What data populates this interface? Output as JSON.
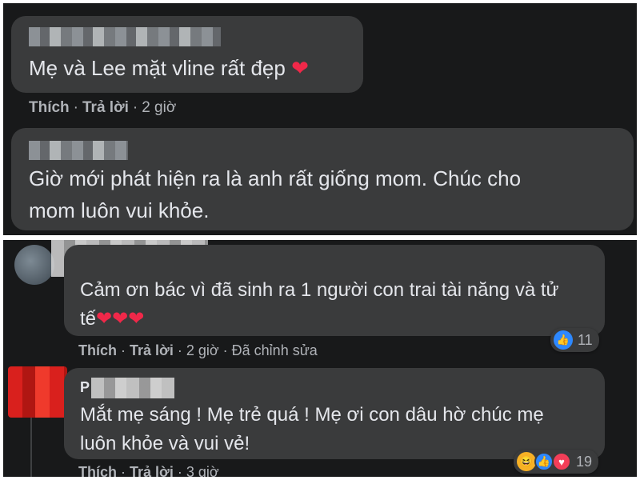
{
  "comments_top": [
    {
      "text": "Mẹ và Lee mặt vline rất đẹp",
      "emoji": "❤",
      "like_label": "Thích",
      "reply_label": "Trả lời",
      "time": "2 giờ"
    },
    {
      "text_line1": "Giờ mới phát hiện ra là anh rất giống mom. Chúc cho",
      "text_line2": "mom luôn vui khỏe."
    }
  ],
  "comments_bottom": [
    {
      "text_line1": "Cảm ơn bác vì đã sinh ra 1 người con trai tài năng và tử",
      "text_line2": "tế",
      "emoji": "❤❤❤",
      "reaction_count": "11",
      "like_label": "Thích",
      "reply_label": "Trả lời",
      "time": "2 giờ",
      "edited_label": "Đã chỉnh sửa"
    },
    {
      "name_initial": "P",
      "text_line1": "Mắt mẹ sáng ! Mẹ trẻ quá ! Mẹ ơi con dâu hờ chúc mẹ",
      "text_line2": "luôn khỏe và vui vẻ!",
      "reaction_count": "19",
      "like_label": "Thích",
      "reply_label": "Trả lời",
      "time": "3 giờ"
    }
  ],
  "separator": "·",
  "icons": [
    "like-icon",
    "love-icon",
    "haha-icon",
    "heart-emoji"
  ],
  "colors": {
    "panel_bg": "#18191a",
    "bubble_bg": "#3a3b3c",
    "text": "#e4e6eb",
    "muted": "#b0b3b8",
    "like": "#2d88ff",
    "love": "#f33e58"
  }
}
